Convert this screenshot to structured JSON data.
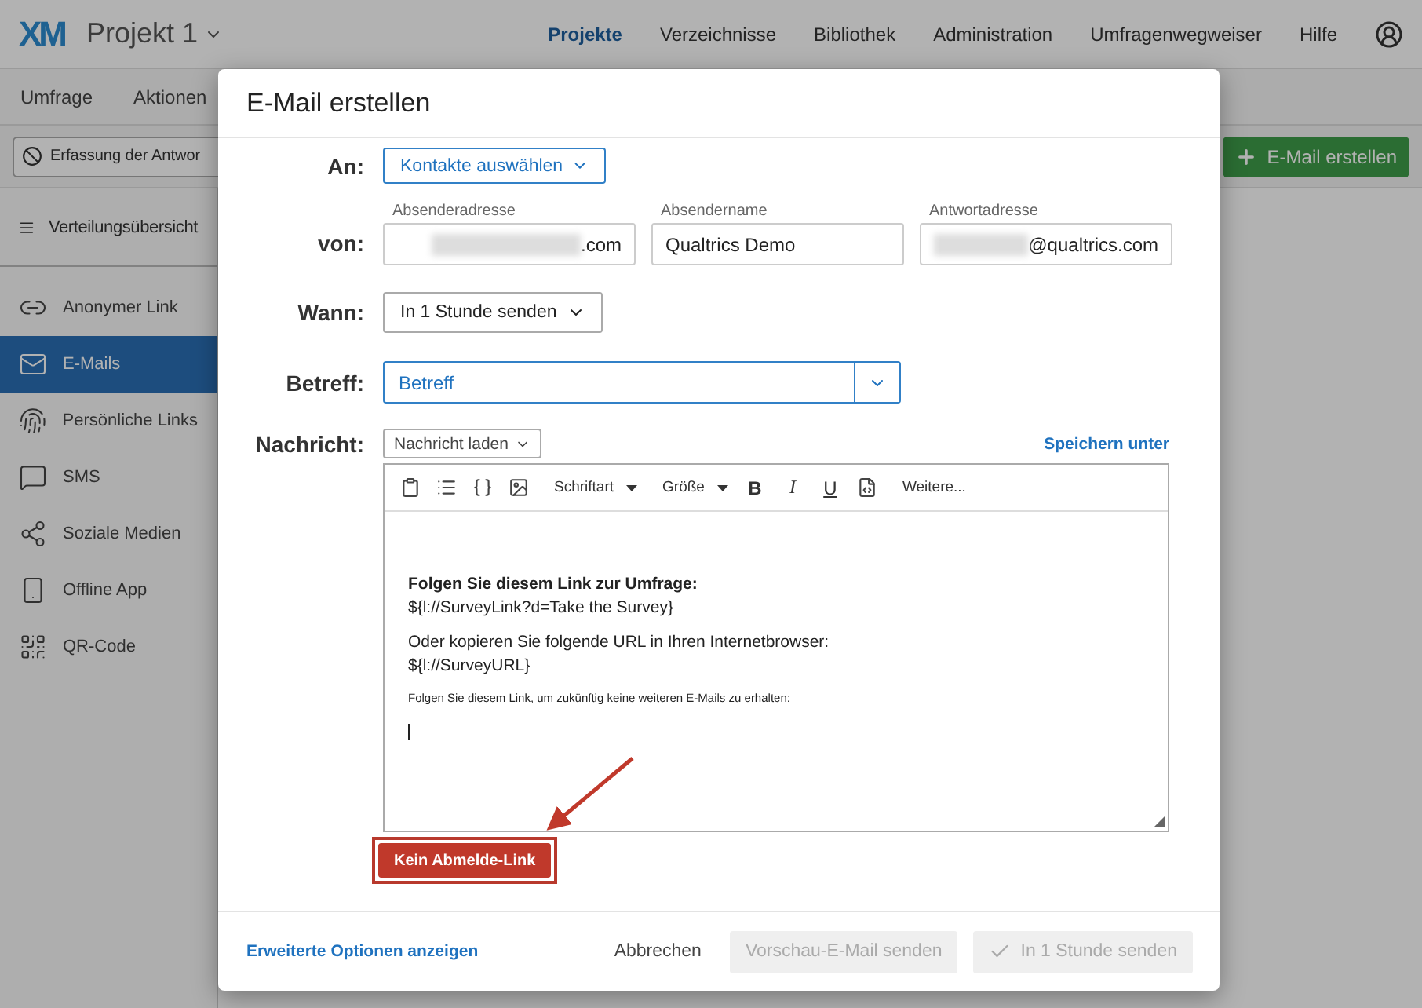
{
  "app": {
    "logo": "XM",
    "project": "Projekt 1",
    "nav": [
      {
        "label": "Projekte",
        "selected": true
      },
      {
        "label": "Verzeichnisse",
        "selected": false
      },
      {
        "label": "Bibliothek",
        "selected": false
      },
      {
        "label": "Administration",
        "selected": false
      },
      {
        "label": "Umfragenwegweiser",
        "selected": false
      },
      {
        "label": "Hilfe",
        "selected": false
      }
    ]
  },
  "subnav": [
    "Umfrage",
    "Aktionen"
  ],
  "toolbar": {
    "status": "Erfassung der Antwor",
    "create_button": "E-Mail erstellen"
  },
  "sidebar": {
    "overview": "Verteilungsübersicht",
    "items": [
      {
        "label": "Anonymer Link",
        "selected": false
      },
      {
        "label": "E-Mails",
        "selected": true
      },
      {
        "label": "Persönliche Links",
        "selected": false
      },
      {
        "label": "SMS",
        "selected": false
      },
      {
        "label": "Soziale Medien",
        "selected": false
      },
      {
        "label": "Offline App",
        "selected": false
      },
      {
        "label": "QR-Code",
        "selected": false
      }
    ]
  },
  "dialog": {
    "title": "E-Mail erstellen",
    "to": {
      "label": "An:",
      "button": "Kontakte auswählen"
    },
    "from": {
      "label": "von:",
      "fields": [
        {
          "caption": "Absenderadresse",
          "value": ".com",
          "redacted": true
        },
        {
          "caption": "Absendername",
          "value": "Qualtrics Demo",
          "redacted": false
        },
        {
          "caption": "Antwortadresse",
          "value": "@qualtrics.com",
          "redacted": true
        }
      ]
    },
    "when": {
      "label": "Wann:",
      "value": "In 1 Stunde senden"
    },
    "subject": {
      "label": "Betreff:",
      "value": "Betreff"
    },
    "message": {
      "label": "Nachricht:",
      "load": "Nachricht laden",
      "save": "Speichern unter",
      "toolbar": {
        "dropdowns": [
          "Schriftart",
          "Größe"
        ],
        "format": [
          "B",
          "I",
          "U"
        ],
        "more": "Weitere..."
      },
      "paragraphs": [
        [
          {
            "kind": "heading",
            "text": "Folgen Sie diesem Link zur Umfrage:"
          },
          {
            "kind": "body",
            "text": "${l://SurveyLink?d=Take the Survey}"
          }
        ],
        [
          {
            "kind": "body",
            "text": "Oder kopieren Sie folgende URL in Ihren Internetbrowser:"
          },
          {
            "kind": "body",
            "text": "${l://SurveyURL}"
          }
        ],
        [
          {
            "kind": "fine",
            "text": "Folgen Sie diesem Link, um zukünftig keine weiteren E-Mails zu erhalten:"
          }
        ]
      ]
    },
    "unsubscribe": {
      "label": "Kein Abmelde-Link",
      "highlighted": true
    },
    "footer": {
      "advanced": "Erweiterte Optionen anzeigen",
      "cancel": "Abbrechen",
      "buttons": [
        {
          "label": "Vorschau-E-Mail senden",
          "disabled": true,
          "kind": "plain"
        },
        {
          "label": "In 1 Stunde senden",
          "disabled": true,
          "kind": "check"
        }
      ]
    }
  }
}
